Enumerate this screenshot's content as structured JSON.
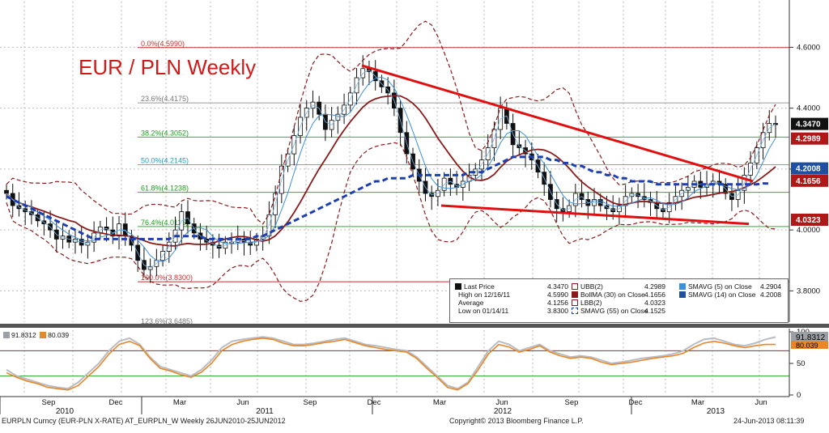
{
  "header": {
    "title": "EUR / PLN Weekly"
  },
  "footer": {
    "left": "EURPLN Curncy (EUR-PLN X-RATE) AT_EURPLN_W  Weekly 26JUN2010-25JUN2012",
    "center": "Copyright© 2013 Bloomberg Finance L.P.",
    "right": "24-Jun-2013 08:11:39"
  },
  "legend": {
    "last_price_label": "Last Price",
    "last_price_value": "4.3470",
    "high_label": "High on 12/16/11",
    "high_value": "4.5990",
    "average_label": "Average",
    "average_value": "4.1256",
    "low_label": "Low on 01/14/11",
    "low_value": "3.8300",
    "ubb_label": "UBB(2)",
    "ubb_value": "4.2989",
    "bollma_label": "BollMA (30) on Close",
    "bollma_value": "4.1656",
    "lbb_label": "LBB(2)",
    "lbb_value": "4.0323",
    "smavg55_label": "SMAVG (55) on Close",
    "smavg55_value": "4.1525",
    "smavg5_label": "SMAVG (5) on Close",
    "smavg5_value": "4.2904",
    "smavg14_label": "SMAVG (14) on Close",
    "smavg14_value": "4.2008"
  },
  "oscillator": {
    "value1": "91.8312",
    "value2": "80.039",
    "color1": "#9aa0a6",
    "color2": "#e8862a"
  },
  "colors": {
    "candle": "#111111",
    "bb": "#8b1a1a",
    "sma55": "#1e3fb0",
    "sma14": "#3c8fd8",
    "trend": "#e01010",
    "fib_green": "#28b428",
    "fib_red": "#c83030",
    "fib_cyan": "#2cc8e6"
  },
  "chart_data": [
    {
      "type": "candlestick",
      "title": "EUR / PLN Weekly",
      "x_tick_labels": [
        "Sep",
        "Dec",
        "Mar",
        "Jun",
        "Sep",
        "Dec",
        "Mar",
        "Jun",
        "Sep",
        "Dec",
        "Mar",
        "Jun"
      ],
      "x_year_labels": [
        "2010",
        "2011",
        "2012",
        "2013"
      ],
      "y_tick_labels": [
        "4.6000",
        "4.4000",
        "4.2000",
        "4.0000",
        "3.8000"
      ],
      "ylim": [
        3.7,
        4.75
      ],
      "fibonacci": [
        {
          "label": "0.0%(4.5990)",
          "value": 4.599
        },
        {
          "label": "23.6%(4.4175)",
          "value": 4.4175
        },
        {
          "label": "38.2%(4.3052)",
          "value": 4.3052
        },
        {
          "label": "50.0%(4.2145)",
          "value": 4.2145
        },
        {
          "label": "61.8%(4.1238)",
          "value": 4.1238
        },
        {
          "label": "76.4%(4.0115)",
          "value": 4.0115
        },
        {
          "label": "100.0%(3.8300)",
          "value": 3.83
        },
        {
          "label": "123.6%(3.6485)",
          "value": 3.6485
        }
      ],
      "price_tags": [
        {
          "label": "4.3470",
          "value": 4.347
        },
        {
          "label": "4.2989",
          "value": 4.2989
        },
        {
          "label": "4.2008",
          "value": 4.2008
        },
        {
          "label": "4.1656",
          "value": 4.1656
        },
        {
          "label": "4.0323",
          "value": 4.0323
        }
      ],
      "series": [
        {
          "name": "Last Price",
          "close": [
            4.12,
            4.08,
            4.07,
            4.06,
            4.05,
            4.03,
            4.02,
            4.0,
            3.97,
            3.98,
            3.96,
            3.97,
            3.95,
            3.96,
            3.99,
            4.01,
            4.0,
            3.98,
            4.02,
            3.98,
            3.95,
            3.9,
            3.87,
            3.88,
            3.9,
            3.93,
            3.96,
            4.0,
            4.06,
            4.02,
            3.99,
            3.97,
            3.96,
            3.95,
            3.94,
            3.96,
            3.96,
            3.97,
            3.96,
            3.95,
            3.97,
            3.98,
            4.05,
            4.12,
            4.21,
            4.25,
            4.31,
            4.37,
            4.4,
            4.42,
            4.38,
            4.33,
            4.36,
            4.38,
            4.41,
            4.45,
            4.5,
            4.53,
            4.52,
            4.49,
            4.47,
            4.45,
            4.4,
            4.32,
            4.25,
            4.2,
            4.16,
            4.12,
            4.11,
            4.13,
            4.17,
            4.15,
            4.14,
            4.16,
            4.18,
            4.2,
            4.23,
            4.27,
            4.33,
            4.4,
            4.35,
            4.28,
            4.27,
            4.25,
            4.23,
            4.19,
            4.15,
            4.1,
            4.07,
            4.06,
            4.08,
            4.12,
            4.1,
            4.08,
            4.1,
            4.08,
            4.07,
            4.06,
            4.08,
            4.11,
            4.12,
            4.11,
            4.1,
            4.09,
            4.07,
            4.06,
            4.09,
            4.11,
            4.13,
            4.14,
            4.16,
            4.14,
            4.15,
            4.16,
            4.15,
            4.12,
            4.1,
            4.13,
            4.18,
            4.22,
            4.27,
            4.32,
            4.35,
            4.347
          ]
        },
        {
          "name": "SMAVG (55) on Close",
          "values": [
            4.11,
            4.1,
            4.09,
            4.08,
            4.07,
            4.06,
            4.05,
            4.04,
            4.03,
            4.02,
            4.01,
            4.0,
            3.99,
            3.98,
            3.97,
            3.97,
            3.97,
            3.97,
            3.97,
            3.97,
            3.97,
            3.97,
            3.97,
            3.97,
            3.97,
            3.97,
            3.97,
            3.98,
            3.98,
            3.98,
            3.98,
            3.98,
            3.97,
            3.97,
            3.97,
            3.97,
            3.97,
            3.97,
            3.97,
            3.97,
            3.98,
            3.98,
            3.99,
            4.0,
            4.01,
            4.02,
            4.03,
            4.04,
            4.05,
            4.06,
            4.07,
            4.08,
            4.09,
            4.1,
            4.11,
            4.12,
            4.13,
            4.14,
            4.15,
            4.16,
            4.16,
            4.17,
            4.17,
            4.17,
            4.17,
            4.18,
            4.18,
            4.18,
            4.18,
            4.18,
            4.18,
            4.18,
            4.18,
            4.18,
            4.19,
            4.19,
            4.19,
            4.2,
            4.21,
            4.22,
            4.23,
            4.24,
            4.24,
            4.24,
            4.24,
            4.24,
            4.24,
            4.23,
            4.23,
            4.22,
            4.22,
            4.21,
            4.21,
            4.2,
            4.19,
            4.19,
            4.18,
            4.18,
            4.17,
            4.17,
            4.16,
            4.16,
            4.16,
            4.16,
            4.15,
            4.15,
            4.15,
            4.15,
            4.15,
            4.15,
            4.15,
            4.15,
            4.15,
            4.15,
            4.15,
            4.15,
            4.15,
            4.15,
            4.15,
            4.15,
            4.15,
            4.153,
            4.1525
          ]
        }
      ]
    },
    {
      "type": "line",
      "title": "",
      "y_tick_labels": [
        "100",
        "50",
        "0"
      ],
      "ylim": [
        0,
        100
      ],
      "series": [
        {
          "name": "91.8312",
          "values": [
            40,
            30,
            25,
            20,
            15,
            12,
            10,
            20,
            35,
            50,
            70,
            85,
            90,
            80,
            60,
            45,
            40,
            35,
            30,
            40,
            55,
            75,
            85,
            88,
            90,
            92,
            90,
            85,
            80,
            80,
            82,
            85,
            88,
            90,
            85,
            80,
            78,
            75,
            72,
            70,
            60,
            45,
            30,
            15,
            10,
            20,
            45,
            70,
            85,
            80,
            70,
            75,
            80,
            70,
            65,
            60,
            62,
            60,
            55,
            50,
            52,
            55,
            58,
            60,
            62,
            65,
            70,
            80,
            88,
            90,
            85,
            80,
            78,
            82,
            88,
            91.8312
          ]
        },
        {
          "name": "80.039",
          "values": [
            35,
            28,
            22,
            18,
            12,
            10,
            8,
            15,
            30,
            45,
            65,
            80,
            85,
            78,
            58,
            42,
            38,
            32,
            28,
            36,
            50,
            70,
            80,
            85,
            88,
            90,
            88,
            82,
            78,
            78,
            80,
            83,
            85,
            88,
            83,
            78,
            75,
            72,
            70,
            68,
            58,
            42,
            28,
            12,
            8,
            18,
            40,
            65,
            80,
            76,
            68,
            72,
            78,
            68,
            62,
            58,
            60,
            58,
            52,
            48,
            50,
            52,
            55,
            58,
            60,
            62,
            66,
            75,
            82,
            85,
            82,
            78,
            75,
            78,
            80,
            80.039
          ]
        }
      ]
    }
  ]
}
